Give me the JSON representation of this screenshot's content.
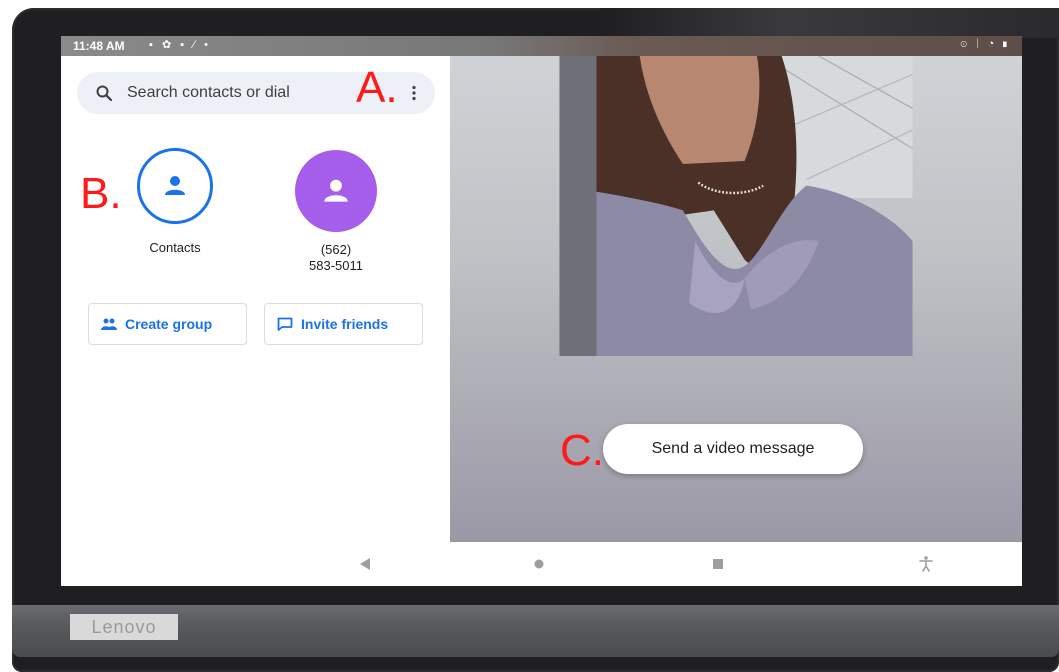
{
  "status_bar": {
    "time": "11:48 AM",
    "left_icons": "▪ ✿ ▪ ⁄ •",
    "right_icons": "⊙ ᛁ ◔ ▮"
  },
  "search": {
    "placeholder": "Search contacts or dial"
  },
  "contacts_tile": {
    "label": "Contacts",
    "icon": "person-icon",
    "accent": "#1a73e8"
  },
  "recent_contact": {
    "line1": "(562)",
    "line2": "583-5011",
    "avatar_color": "#a45eea"
  },
  "actions": {
    "create_group": "Create group",
    "invite_friends": "Invite friends"
  },
  "camera": {
    "video_message_button": "Send a video message"
  },
  "nav": {
    "back": "back-icon",
    "home": "home-icon",
    "recents": "recents-icon",
    "accessibility": "accessibility-icon"
  },
  "annotations": {
    "a": "A.",
    "b": "B.",
    "c": "C."
  },
  "device": {
    "brand": "Lenovo"
  }
}
